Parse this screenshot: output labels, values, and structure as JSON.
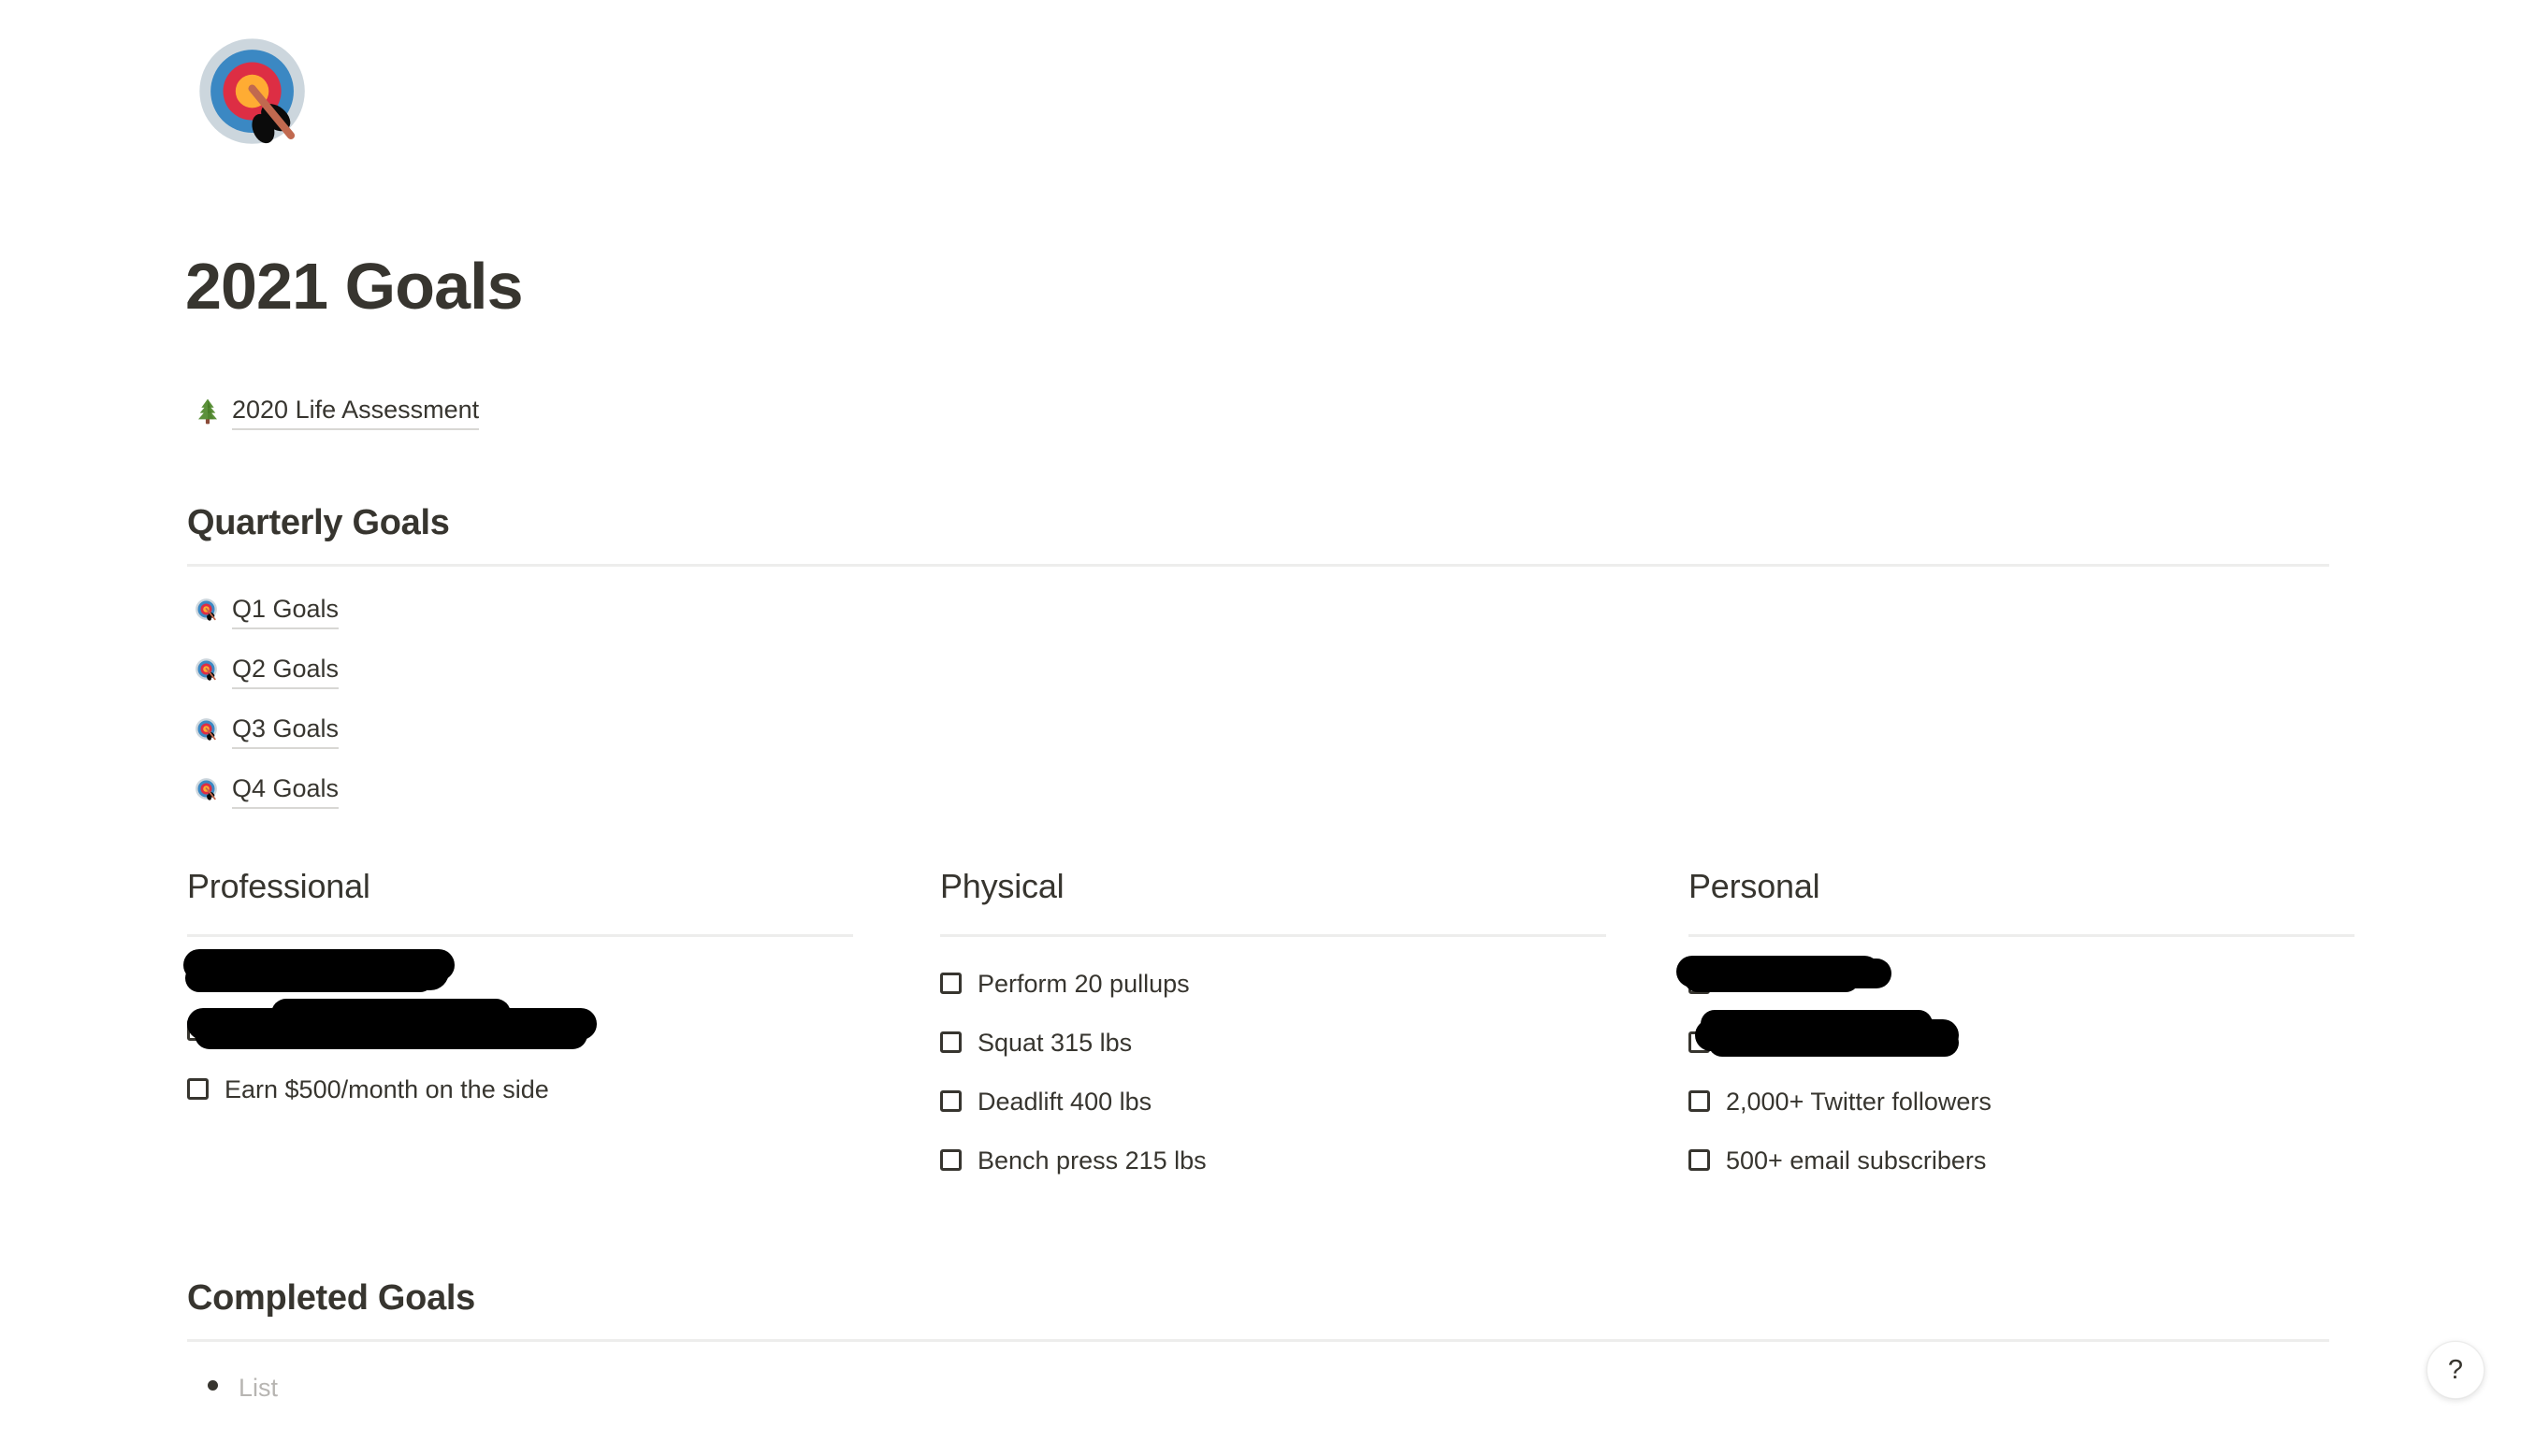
{
  "page": {
    "icon": "dartboard-icon",
    "title": "2021 Goals"
  },
  "related_link": {
    "icon": "evergreen-tree-icon",
    "label": "2020 Life Assessment"
  },
  "quarterly": {
    "heading": "Quarterly Goals",
    "links": [
      {
        "icon": "dartboard-icon",
        "label": "Q1 Goals"
      },
      {
        "icon": "dartboard-icon",
        "label": "Q2 Goals"
      },
      {
        "icon": "dartboard-icon",
        "label": "Q3 Goals"
      },
      {
        "icon": "dartboard-icon",
        "label": "Q4 Goals"
      }
    ]
  },
  "columns": {
    "professional": {
      "heading": "Professional",
      "items": [
        {
          "label": "",
          "checked": false,
          "redacted": true
        },
        {
          "label": "",
          "checked": false,
          "redacted": true
        },
        {
          "label": "Earn $500/month on the side",
          "checked": false,
          "redacted": false
        }
      ]
    },
    "physical": {
      "heading": "Physical",
      "items": [
        {
          "label": "Perform 20 pullups",
          "checked": false,
          "redacted": false
        },
        {
          "label": "Squat 315 lbs",
          "checked": false,
          "redacted": false
        },
        {
          "label": "Deadlift 400 lbs",
          "checked": false,
          "redacted": false
        },
        {
          "label": "Bench press 215 lbs",
          "checked": false,
          "redacted": false
        }
      ]
    },
    "personal": {
      "heading": "Personal",
      "items": [
        {
          "label": "",
          "checked": false,
          "redacted": true
        },
        {
          "label": "",
          "checked": false,
          "redacted": true
        },
        {
          "label": "2,000+ Twitter followers",
          "checked": false,
          "redacted": false
        },
        {
          "label": "500+ email subscribers",
          "checked": false,
          "redacted": false
        }
      ]
    }
  },
  "completed": {
    "heading": "Completed Goals",
    "list_placeholder": "List"
  },
  "help": {
    "label": "?"
  },
  "colors": {
    "text": "#37352f",
    "rule": "#ededec",
    "link_underline": "#d8d7d4",
    "placeholder": "#b7b5b2",
    "redaction": "#000000",
    "background": "#ffffff"
  }
}
